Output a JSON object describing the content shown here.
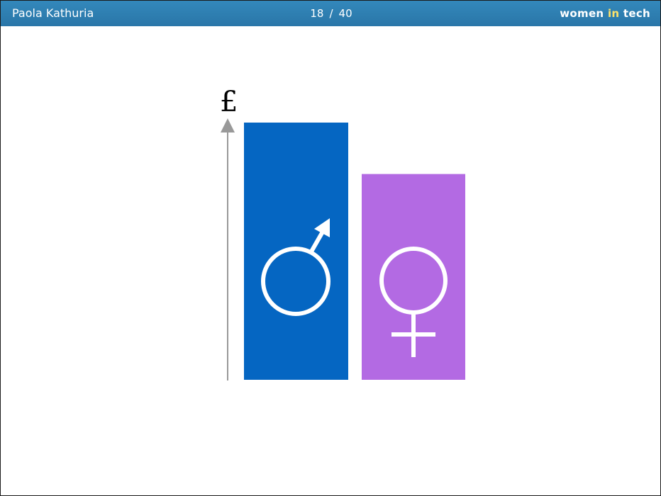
{
  "window": {
    "presenter": "Paola Kathuria",
    "page": {
      "current": "18",
      "separator": "/",
      "total": "40"
    },
    "brand": {
      "part1": "women ",
      "part2": "in",
      "part3": " tech"
    }
  },
  "chart_data": {
    "type": "bar",
    "ylabel": "£",
    "categories": [
      "♂",
      "♀"
    ],
    "values": [
      100,
      80
    ],
    "ylim": [
      0,
      100
    ],
    "colors": [
      "#0566c2",
      "#b36ae3"
    ],
    "grid": false,
    "legend": "none"
  }
}
